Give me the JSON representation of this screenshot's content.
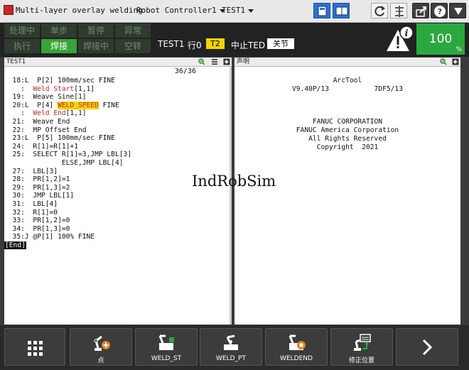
{
  "title_bar": {
    "app_title": "Multi-layer overlay welding",
    "controller": "Robot Controller1",
    "program": "TEST1"
  },
  "status": {
    "row1": [
      {
        "label": "处理中",
        "active": false
      },
      {
        "label": "单步",
        "active": false
      },
      {
        "label": "暂停",
        "active": false
      },
      {
        "label": "异常",
        "active": false
      }
    ],
    "row2": [
      {
        "label": "执行",
        "active": false
      },
      {
        "label": "焊接",
        "active": true
      },
      {
        "label": "焊接中",
        "active": false
      },
      {
        "label": "空转",
        "active": false
      }
    ],
    "program_name": "TEST1",
    "line": "行0",
    "mode": "T2",
    "state": "中止TED",
    "coord": "关节",
    "override": "100",
    "override_unit": "%"
  },
  "left_pane": {
    "title": "TEST1",
    "line_count": "36/36",
    "lines": [
      [
        {
          "t": "  18:L  P[2] 100mm/sec FINE"
        }
      ],
      [
        {
          "t": "    :  "
        },
        {
          "t": "Weld Start",
          "c": "kw"
        },
        {
          "t": "[1,1]"
        }
      ],
      [
        {
          "t": "  19:  Weave Sine[1]"
        }
      ],
      [
        {
          "t": "  20:L  P[4] "
        },
        {
          "t": "WELD_SPEED",
          "c": "hl"
        },
        {
          "t": " FINE"
        }
      ],
      [
        {
          "t": "    :  "
        },
        {
          "t": "Weld End",
          "c": "kw"
        },
        {
          "t": "[1,1]"
        }
      ],
      [
        {
          "t": "  21:  Weave End"
        }
      ],
      [
        {
          "t": "  22:  MP Offset End"
        }
      ],
      [
        {
          "t": "  23:L  P[5] 100mm/sec FINE"
        }
      ],
      [
        {
          "t": "  24:  R[1]=R[1]+1"
        }
      ],
      [
        {
          "t": "  25:  SELECT R[1]=3,JMP LBL[3]"
        }
      ],
      [
        {
          "t": "              ELSE,JMP LBL[4]"
        }
      ],
      [
        {
          "t": "  27:  LBL[3]"
        }
      ],
      [
        {
          "t": "  28:  PR[1,2]=1"
        }
      ],
      [
        {
          "t": "  29:  PR[1,3]=2"
        }
      ],
      [
        {
          "t": "  30:  JMP LBL[1]"
        }
      ],
      [
        {
          "t": "  31:  LBL[4]"
        }
      ],
      [
        {
          "t": "  32:  R[1]=0"
        }
      ],
      [
        {
          "t": "  33:  PR[1,2]=0"
        }
      ],
      [
        {
          "t": "  34:  PR[1,3]=0"
        }
      ],
      [
        {
          "t": "  35:J @P[1] 100% FINE"
        }
      ],
      [
        {
          "t": "[End]",
          "c": "end"
        }
      ]
    ]
  },
  "right_pane": {
    "title": "声明",
    "product": "ArcTool",
    "version_line": "V9.40P/13           7DF5/13",
    "copyright_lines": [
      "FANUC CORPORATION",
      "FANUC America Corporation",
      "All Rights Reserved",
      "Copyright  2021"
    ]
  },
  "watermark": "IndRobSim",
  "function_keys": [
    {
      "label": "",
      "icon": "grid-menu-icon"
    },
    {
      "label": "点",
      "icon": "robot-add-point-icon"
    },
    {
      "label": "WELD_ST",
      "icon": "weld-start-icon"
    },
    {
      "label": "WELD_PT",
      "icon": "weld-point-icon"
    },
    {
      "label": "WELDEND",
      "icon": "weld-end-icon"
    },
    {
      "label": "修正位置",
      "icon": "touchup-position-icon"
    },
    {
      "label": "",
      "icon": "chevron-right-icon"
    }
  ],
  "colors": {
    "status_active": "#36a436",
    "override_bg": "#2aa83f",
    "mode_badge": "#f4d400",
    "weld_keyword": "#c62828"
  }
}
